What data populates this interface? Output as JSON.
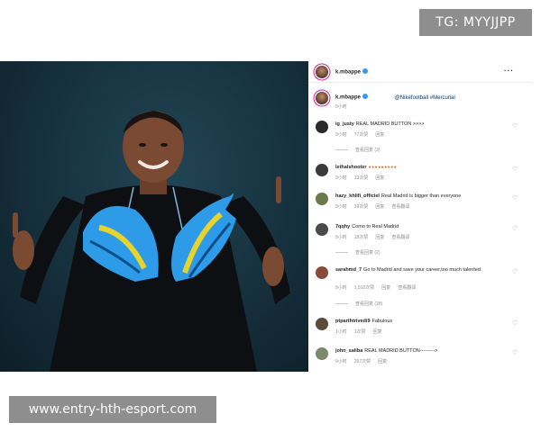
{
  "badges": {
    "tg": "TG: MYYJJPP",
    "site": "www.entry-hth-esport.com"
  },
  "post": {
    "username": "k.mbappe",
    "more": "···",
    "caption_username": "k.mbappe",
    "caption_text": "@Nikefootball #Mercurial",
    "caption_time": "9小时"
  },
  "comments": [
    {
      "user": "ig_justy",
      "text": "REAL MADRID BUTTON >>>>",
      "time": "9小时",
      "likes": "77次赞",
      "reply": "回复",
      "replies": "查看回复 (3)"
    },
    {
      "user": "lethalshooter",
      "text": "",
      "time": "9小时",
      "likes": "13次赞",
      "reply": "回复",
      "replies": ""
    },
    {
      "user": "hazy_khlifi_officiel",
      "text": "Real Madrid is bigger than everyone",
      "time": "9小时",
      "likes": "39次赞",
      "reply": "回复",
      "translate": "查看翻译",
      "replies": ""
    },
    {
      "user": "7qqhy",
      "text": "Como to Real Madrid",
      "time": "9小时",
      "likes": "18次赞",
      "reply": "回复",
      "translate": "查看翻译",
      "replies": "查看回复 (2)"
    },
    {
      "user": "sarahmd_7",
      "text": "Go to Madrid and save your career,too much talented",
      "time": "9小时",
      "likes": "1,510次赞",
      "reply": "回复",
      "translate": "查看翻译",
      "replies": "查看回复 (28)"
    },
    {
      "user": "ptparthtrivedi9",
      "text": "Fabulous",
      "time": "1小时",
      "likes": "1次赞",
      "reply": "回复",
      "replies": ""
    },
    {
      "user": "john_saliba",
      "text": "REAL MADRID BUTTON--------->",
      "time": "9小时",
      "likes": "297次赞",
      "reply": "回复",
      "replies": ""
    }
  ],
  "icons": {
    "heart": "heart-outline-icon",
    "verified": "verified-badge-icon",
    "more": "more-options-icon"
  },
  "colors": {
    "badge_bg": "#8e8e8e",
    "verified": "#3897f0",
    "photo_bg": "#16303d",
    "boot_blue": "#2d9be8",
    "boot_yellow": "#e8d22c"
  }
}
